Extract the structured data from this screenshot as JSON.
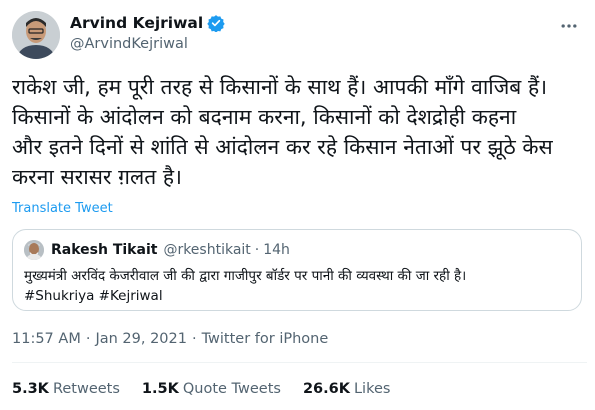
{
  "author": {
    "display_name": "Arvind Kejriwal",
    "handle": "@ArvindKejriwal",
    "verified": true,
    "badge_color": "#1d9bf0"
  },
  "tweet": {
    "text": "राकेश जी, हम पूरी तरह से किसानों के साथ हैं। आपकी माँगे वाजिब हैं।\nकिसानों के आंदोलन को बदनाम करना, किसानों को देशद्रोही कहना\nऔर इतने दिनों से शांति से आंदोलन कर रहे किसान नेताओं पर झूठे केस\nकरना सरासर ग़लत है।",
    "translate_label": "Translate Tweet",
    "time": "11:57 AM",
    "separator": "·",
    "date": "Jan 29, 2021",
    "source": "Twitter for iPhone"
  },
  "quoted": {
    "display_name": "Rakesh Tikait",
    "handle": "@rkeshtikait",
    "separator": "·",
    "time": "14h",
    "text": "मुख्यमंत्री अरविंद केजरीवाल जी की द्वारा गाजीपुर बॉर्डर पर पानी की व्यवस्था की जा रही है।\n#Shukriya #Kejriwal"
  },
  "stats": {
    "retweets_count": "5.3K",
    "retweets_label": "Retweets",
    "quotes_count": "1.5K",
    "quotes_label": "Quote Tweets",
    "likes_count": "26.6K",
    "likes_label": "Likes"
  },
  "icons": {
    "verified": "verified-badge-icon",
    "more": "more-options-icon"
  },
  "colors": {
    "accent": "#1d9bf0",
    "secondary_text": "#536471",
    "primary_text": "#0f1419",
    "border": "#cfd9de"
  }
}
